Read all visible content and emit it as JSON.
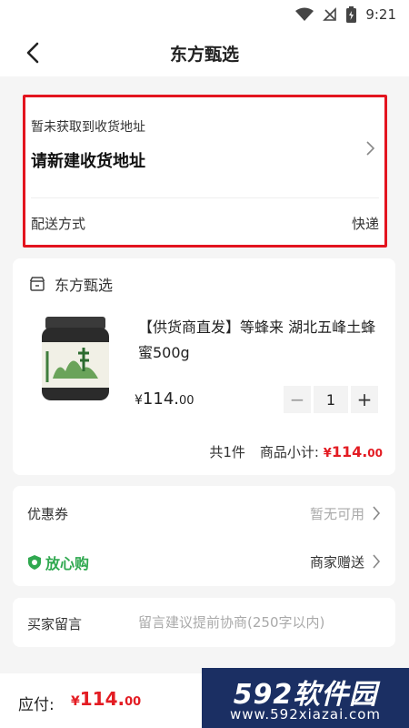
{
  "status_bar": {
    "time": "9:21"
  },
  "nav": {
    "title": "东方甄选",
    "back_icon": "chevron-left-icon"
  },
  "address": {
    "hint": "暂未获取到收货地址",
    "prompt": "请新建收货地址",
    "delivery_label": "配送方式",
    "delivery_value": "快递"
  },
  "product_card": {
    "shop_name": "东方甄选",
    "title": "【供货商直发】等蜂来 湖北五峰土蜂蜜500g",
    "price": {
      "currency": "¥",
      "integer": "114.",
      "decimal": "00"
    },
    "quantity": "1",
    "minus": "−",
    "plus": "+",
    "count_text": "共1件",
    "subtotal_label": "商品小计:",
    "subtotal": {
      "currency": "¥",
      "integer": "114.",
      "decimal": "00"
    }
  },
  "benefits": {
    "coupon_label": "优惠券",
    "coupon_value": "暂无可用",
    "safe_label": "放心购",
    "safe_value": "商家赠送"
  },
  "message": {
    "label": "买家留言",
    "placeholder": "留言建议提前协商(250字以内)"
  },
  "bottom": {
    "pay_label": "应付:",
    "amount": {
      "currency": "¥",
      "integer": "114.",
      "decimal": "00"
    }
  },
  "watermark": {
    "logo": "592软件园",
    "url": "www.592xiazai.com"
  },
  "colors": {
    "accent_red": "#e31c23",
    "safe_green": "#2fa84f",
    "highlight_border": "#e3141f"
  }
}
